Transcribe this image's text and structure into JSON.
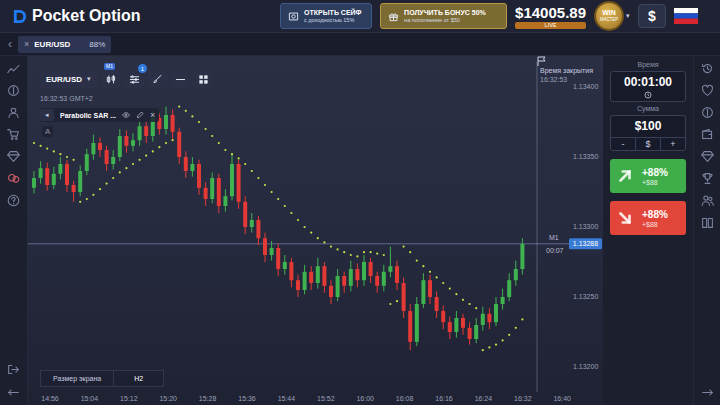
{
  "logo": {
    "text": "Pocket Option"
  },
  "promos": [
    {
      "kind": "safe",
      "title": "ОТКРЫТЬ СЕЙФ",
      "subtitle": "с доходностью 15%"
    },
    {
      "kind": "bonus",
      "title": "ПОЛУЧИТЬ БОНУС 50%",
      "subtitle": "на пополнение от $50"
    }
  ],
  "account": {
    "balance": "$14005.89",
    "mode": "LIVE"
  },
  "level_badge": {
    "top": "WIN",
    "bottom": "МАСТЕР",
    "caret": "▾"
  },
  "deposit_button": {
    "label": "$"
  },
  "tab_bar": {
    "scroll_left": "‹",
    "tabs": [
      {
        "label": "EUR/USD",
        "payout": "88%",
        "close": "×",
        "selected": true
      }
    ]
  },
  "chart": {
    "asset": "EUR/USD",
    "caret": "▾",
    "timeframe": "M1",
    "indicator_count": "1",
    "server_time": "16:32:53 GMT+2",
    "indicator": {
      "collapse": "◂",
      "name": "Parabolic SAR ...",
      "close": "×"
    },
    "drawing_label": "A",
    "closing_time": {
      "label": "Время закрытия",
      "time": "16:32:53"
    },
    "price_ticks": [
      "1.13400",
      "1.13350",
      "1.13300",
      "1.13250",
      "1.13200"
    ],
    "current_price": "1.13288",
    "candle_timer": {
      "timeframe": "M1",
      "countdown": "00:07"
    },
    "time_ticks": [
      "14:56",
      "15:04",
      "15:12",
      "15:20",
      "15:28",
      "15:36",
      "15:44",
      "15:52",
      "16:00",
      "16:08",
      "16:16",
      "16:24",
      "16:32",
      "16:40"
    ],
    "candles": [
      [
        1.13328,
        1.1334,
        1.13324,
        1.13335
      ],
      [
        1.13335,
        1.13347,
        1.13331,
        1.13342
      ],
      [
        1.13342,
        1.13346,
        1.13326,
        1.1333
      ],
      [
        1.1333,
        1.13343,
        1.13327,
        1.13338
      ],
      [
        1.13338,
        1.1335,
        1.13334,
        1.13345
      ],
      [
        1.13345,
        1.13348,
        1.13325,
        1.1333
      ],
      [
        1.1333,
        1.13333,
        1.13318,
        1.13325
      ],
      [
        1.13325,
        1.13344,
        1.13322,
        1.1334
      ],
      [
        1.1334,
        1.13356,
        1.13337,
        1.13352
      ],
      [
        1.13352,
        1.13366,
        1.13348,
        1.1336
      ],
      [
        1.1336,
        1.13364,
        1.1335,
        1.13355
      ],
      [
        1.13355,
        1.13358,
        1.1334,
        1.13345
      ],
      [
        1.13345,
        1.13355,
        1.13341,
        1.1335
      ],
      [
        1.1335,
        1.1337,
        1.13347,
        1.13365
      ],
      [
        1.13365,
        1.13369,
        1.13353,
        1.13358
      ],
      [
        1.13358,
        1.13367,
        1.13354,
        1.13362
      ],
      [
        1.13362,
        1.13377,
        1.13358,
        1.13372
      ],
      [
        1.13372,
        1.13376,
        1.1336,
        1.13365
      ],
      [
        1.13365,
        1.13383,
        1.13361,
        1.13378
      ],
      [
        1.13378,
        1.13381,
        1.13366,
        1.1337
      ],
      [
        1.1337,
        1.13386,
        1.13366,
        1.1338
      ],
      [
        1.1338,
        1.13384,
        1.13363,
        1.13368
      ],
      [
        1.13368,
        1.13371,
        1.13345,
        1.1335
      ],
      [
        1.1335,
        1.13354,
        1.13335,
        1.1334
      ],
      [
        1.1334,
        1.1335,
        1.13336,
        1.13345
      ],
      [
        1.13345,
        1.13348,
        1.13323,
        1.13328
      ],
      [
        1.13328,
        1.13332,
        1.13315,
        1.1332
      ],
      [
        1.1332,
        1.13339,
        1.13317,
        1.13335
      ],
      [
        1.13335,
        1.13338,
        1.1331,
        1.13315
      ],
      [
        1.13315,
        1.13327,
        1.13311,
        1.13322
      ],
      [
        1.13322,
        1.13352,
        1.13319,
        1.13345
      ],
      [
        1.13345,
        1.13348,
        1.13313,
        1.13318
      ],
      [
        1.13318,
        1.13322,
        1.13295,
        1.133
      ],
      [
        1.133,
        1.1331,
        1.13296,
        1.13305
      ],
      [
        1.13305,
        1.13308,
        1.13287,
        1.13292
      ],
      [
        1.13292,
        1.13296,
        1.13275,
        1.1328
      ],
      [
        1.1328,
        1.1329,
        1.13276,
        1.13285
      ],
      [
        1.13285,
        1.13288,
        1.13265,
        1.1327
      ],
      [
        1.1327,
        1.1328,
        1.13266,
        1.13275
      ],
      [
        1.13275,
        1.13278,
        1.13257,
        1.13262
      ],
      [
        1.13262,
        1.13266,
        1.1325,
        1.13255
      ],
      [
        1.13255,
        1.13273,
        1.13252,
        1.13268
      ],
      [
        1.13268,
        1.13272,
        1.13255,
        1.1326
      ],
      [
        1.1326,
        1.13278,
        1.13256,
        1.13272
      ],
      [
        1.13272,
        1.13275,
        1.13253,
        1.13258
      ],
      [
        1.13258,
        1.13262,
        1.13245,
        1.1325
      ],
      [
        1.1325,
        1.1327,
        1.13247,
        1.13265
      ],
      [
        1.13265,
        1.13268,
        1.13253,
        1.13258
      ],
      [
        1.13258,
        1.13276,
        1.13254,
        1.1327
      ],
      [
        1.1327,
        1.13274,
        1.13257,
        1.13262
      ],
      [
        1.13262,
        1.1328,
        1.13258,
        1.13275
      ],
      [
        1.13275,
        1.13278,
        1.1326,
        1.13265
      ],
      [
        1.13265,
        1.13268,
        1.13253,
        1.13258
      ],
      [
        1.13258,
        1.13273,
        1.13254,
        1.13268
      ],
      [
        1.13268,
        1.13286,
        1.13264,
        1.13272
      ],
      [
        1.13272,
        1.13276,
        1.13255,
        1.1326
      ],
      [
        1.1326,
        1.13264,
        1.13235,
        1.1324
      ],
      [
        1.1324,
        1.13245,
        1.13212,
        1.13218
      ],
      [
        1.13218,
        1.1325,
        1.13215,
        1.13245
      ],
      [
        1.13245,
        1.13267,
        1.13242,
        1.13262
      ],
      [
        1.13262,
        1.13266,
        1.13245,
        1.1325
      ],
      [
        1.1325,
        1.13254,
        1.13235,
        1.1324
      ],
      [
        1.1324,
        1.13244,
        1.13227,
        1.13232
      ],
      [
        1.13232,
        1.13236,
        1.1322,
        1.13225
      ],
      [
        1.13225,
        1.1324,
        1.13221,
        1.13235
      ],
      [
        1.13235,
        1.13238,
        1.13223,
        1.13228
      ],
      [
        1.13228,
        1.13232,
        1.13216,
        1.1322
      ],
      [
        1.1322,
        1.13235,
        1.13217,
        1.1323
      ],
      [
        1.1323,
        1.13243,
        1.13226,
        1.13238
      ],
      [
        1.13238,
        1.13242,
        1.13227,
        1.13232
      ],
      [
        1.13232,
        1.1325,
        1.13229,
        1.13245
      ],
      [
        1.13245,
        1.13256,
        1.13241,
        1.1325
      ],
      [
        1.1325,
        1.13267,
        1.13247,
        1.13262
      ],
      [
        1.13262,
        1.13276,
        1.13258,
        1.1327
      ],
      [
        1.1327,
        1.13292,
        1.13266,
        1.13288
      ]
    ],
    "sar": [
      1.1336,
      1.13358,
      1.13356,
      1.13354,
      1.13352,
      1.1335,
      1.13348,
      1.13318,
      1.1332,
      1.13323,
      1.13327,
      1.13331,
      1.13335,
      1.13339,
      1.13342,
      1.13345,
      1.13348,
      1.13351,
      1.13354,
      1.13357,
      1.1336,
      1.13362,
      1.13386,
      1.13383,
      1.13379,
      1.13375,
      1.1337,
      1.13365,
      1.1336,
      1.13355,
      1.13352,
      1.13349,
      1.13345,
      1.1334,
      1.13335,
      1.1333,
      1.13325,
      1.1332,
      1.13315,
      1.1331,
      1.13305,
      1.133,
      1.13296,
      1.13292,
      1.13289,
      1.13286,
      1.13284,
      1.13282,
      1.1328,
      1.13279,
      1.13282,
      1.13282,
      1.13281,
      1.1328,
      1.13245,
      1.13247,
      1.13286,
      1.13282,
      1.13276,
      1.13272,
      1.13268,
      1.13264,
      1.1326,
      1.13256,
      1.13252,
      1.13248,
      1.13245,
      1.13242,
      1.13212,
      1.13214,
      1.13216,
      1.13219,
      1.13223,
      1.13228,
      1.13234
    ],
    "screen_size": {
      "label": "Размер экрана",
      "value": "H2"
    }
  },
  "trade_panel": {
    "time": {
      "label": "Время",
      "value": "00:01:00"
    },
    "amount": {
      "label": "Сумма",
      "value": "$100",
      "minus": "-",
      "currency": "$",
      "plus": "+"
    },
    "buttons": [
      {
        "kind": "up",
        "percent": "+88%",
        "profit": "+$88",
        "color": "#3fae4a"
      },
      {
        "kind": "down",
        "percent": "+88%",
        "profit": "+$88",
        "color": "#e2463b"
      }
    ]
  }
}
